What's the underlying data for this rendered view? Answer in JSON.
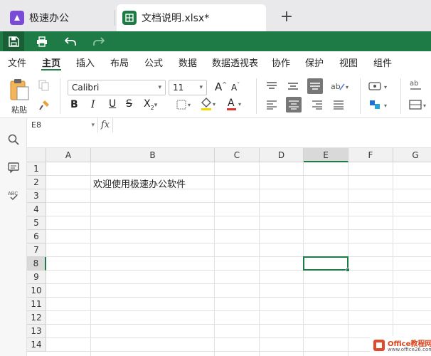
{
  "tabs": [
    {
      "label": "极速办公",
      "icon": "app-logo-icon",
      "active": false
    },
    {
      "label": "文档说明.xlsx*",
      "icon": "spreadsheet-icon",
      "active": true
    }
  ],
  "quick_access": [
    "save-icon",
    "print-icon",
    "undo-icon",
    "redo-icon"
  ],
  "menu": [
    "文件",
    "主页",
    "插入",
    "布局",
    "公式",
    "数据",
    "数据透视表",
    "协作",
    "保护",
    "视图",
    "组件"
  ],
  "active_menu": "主页",
  "ribbon": {
    "paste_label": "粘贴",
    "font_name": "Calibri",
    "font_size": "11",
    "bold": "B",
    "italic": "I",
    "underline": "U",
    "strike": "S",
    "font_color_letter": "A",
    "font_color": "#e03030",
    "fill_color": "#f2d600",
    "subscript": "X",
    "grow_font": "A",
    "shrink_font": "A"
  },
  "formula_bar": {
    "cell_ref": "E8",
    "fx": "fx",
    "content": ""
  },
  "sheet": {
    "columns": [
      "A",
      "B",
      "C",
      "D",
      "E",
      "F",
      "G"
    ],
    "rows": [
      "1",
      "2",
      "3",
      "4",
      "5",
      "6",
      "7",
      "8",
      "9",
      "10",
      "11",
      "12",
      "13",
      "14"
    ],
    "selected_cell": "E8",
    "cells": [
      {
        "ref": "B2",
        "value": "欢迎使用极速办公软件"
      }
    ]
  },
  "watermark": {
    "title": "Office教程网",
    "url": "www.office26.com"
  },
  "colors": {
    "accent": "#1e7b45",
    "tab_bg": "#e9e9ec"
  }
}
